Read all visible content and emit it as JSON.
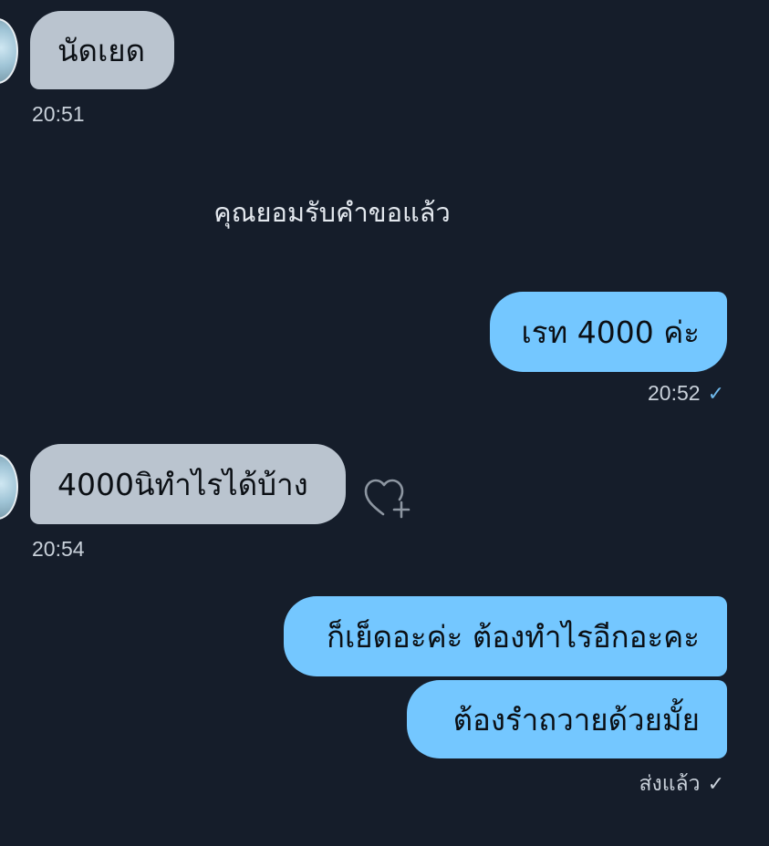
{
  "conversation": {
    "messages": [
      {
        "text": "นัดเยด",
        "time": "20:51"
      },
      {
        "text": "4000นิทำไรได้บ้าง",
        "time": "20:54"
      }
    ],
    "system_notice": "คุณยอมรับคำขอแล้ว",
    "outgoing": [
      {
        "text": "เรท 4000 ค่ะ",
        "time": "20:52"
      },
      {
        "text": "ก็เย็ดอะค่ะ ต้องทำไรอีกอะคะ"
      },
      {
        "text": "ต้องรำถวายด้วยมั้ย"
      }
    ],
    "sent_status": "ส่งแล้ว"
  },
  "icons": {
    "read_check": "check-icon",
    "react": "heart-plus-icon",
    "avatar": "avatar"
  },
  "colors": {
    "background": "#151d2a",
    "incoming_bubble": "#bac4cf",
    "outgoing_bubble": "#74c7ff",
    "check": "#6fb8ea"
  }
}
